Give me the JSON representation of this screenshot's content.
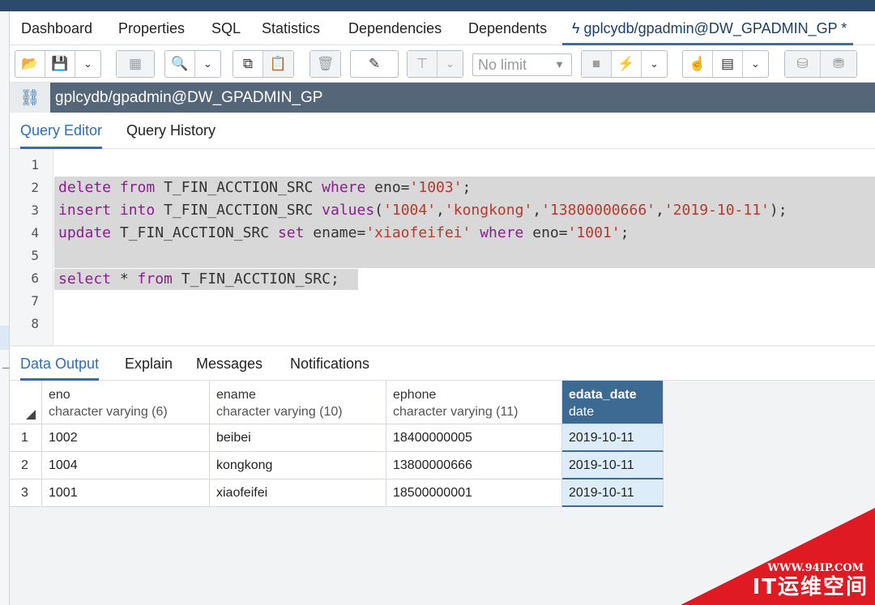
{
  "main_tabs": [
    {
      "label": "Dashboard"
    },
    {
      "label": "Properties"
    },
    {
      "label": "SQL"
    },
    {
      "label": "Statistics"
    },
    {
      "label": "Dependencies"
    },
    {
      "label": "Dependents"
    },
    {
      "label": "gplcydb/gpadmin@DW_GPADMIN_GP *"
    }
  ],
  "toolbar": {
    "icons": {
      "open": "📂",
      "save": "💾",
      "caret": "⌄",
      "grid": "▦",
      "find": "🔍",
      "copy": "⧉",
      "paste": "📋",
      "delete": "🗑",
      "edit": "✎",
      "filter": "⊤",
      "stop": "■",
      "execute": "⚡",
      "explain": "☝",
      "explain_analyze": "▤",
      "commit": "⛁",
      "rollback": "⛃"
    },
    "limit_value": "No limit",
    "limit_caret": "▼"
  },
  "connection": {
    "icon": "⛓",
    "title": "gplcydb/gpadmin@DW_GPADMIN_GP"
  },
  "editor_tabs": [
    {
      "label": "Query Editor"
    },
    {
      "label": "Query History"
    }
  ],
  "editor": {
    "line_numbers": [
      "1",
      "2",
      "3",
      "4",
      "5",
      "6",
      "7",
      "8"
    ],
    "lines": {
      "l2": {
        "kw1": "delete",
        "sp1": " ",
        "kw2": "from",
        "t1": " T_FIN_ACCTION_SRC ",
        "kw3": "where",
        "t2": " eno=",
        "s1": "'1003'",
        "t3": ";"
      },
      "l3": {
        "kw1": "insert",
        "sp1": " ",
        "kw2": "into",
        "t1": " T_FIN_ACCTION_SRC ",
        "kw3": "values",
        "t2": "(",
        "s1": "'1004'",
        "c1": ",",
        "s2": "'kongkong'",
        "c2": ",",
        "s3": "'13800000666'",
        "c3": ",",
        "s4": "'2019-10-11'",
        "t3": ");"
      },
      "l4": {
        "kw1": "update",
        "t1": " T_FIN_ACCTION_SRC ",
        "kw2": "set",
        "t2": " ename=",
        "s1": "'xiaofeifei'",
        "sp1": " ",
        "kw3": "where",
        "t3": " eno=",
        "s2": "'1001'",
        "t4": ";"
      },
      "l6": {
        "kw1": "select",
        "t1": " * ",
        "kw2": "from",
        "t2": " T_FIN_ACCTION_SRC;"
      }
    }
  },
  "results_tabs": [
    {
      "label": "Data Output"
    },
    {
      "label": "Explain"
    },
    {
      "label": "Messages"
    },
    {
      "label": "Notifications"
    }
  ],
  "grid": {
    "columns": [
      {
        "name": "eno",
        "type": "character varying (6)"
      },
      {
        "name": "ename",
        "type": "character varying (10)"
      },
      {
        "name": "ephone",
        "type": "character varying (11)"
      },
      {
        "name": "edata_date",
        "type": "date"
      }
    ],
    "rows": [
      {
        "num": "1",
        "cells": [
          "1002",
          "beibei",
          "18400000005",
          "2019-10-11"
        ]
      },
      {
        "num": "2",
        "cells": [
          "1004",
          "kongkong",
          "13800000666",
          "2019-10-11"
        ]
      },
      {
        "num": "3",
        "cells": [
          "1001",
          "xiaofeifei",
          "18500000001",
          "2019-10-11"
        ]
      }
    ]
  },
  "watermark": {
    "url": "WWW.94IP.COM",
    "brand": "IT运维空间"
  },
  "colors": {
    "connection_bar": "#546677",
    "active_tab": "#2a6ebd",
    "selected_header": "#3c6a92",
    "keyword": "#8a1d8f",
    "string": "#b43a2e",
    "watermark": "#e01a22"
  }
}
